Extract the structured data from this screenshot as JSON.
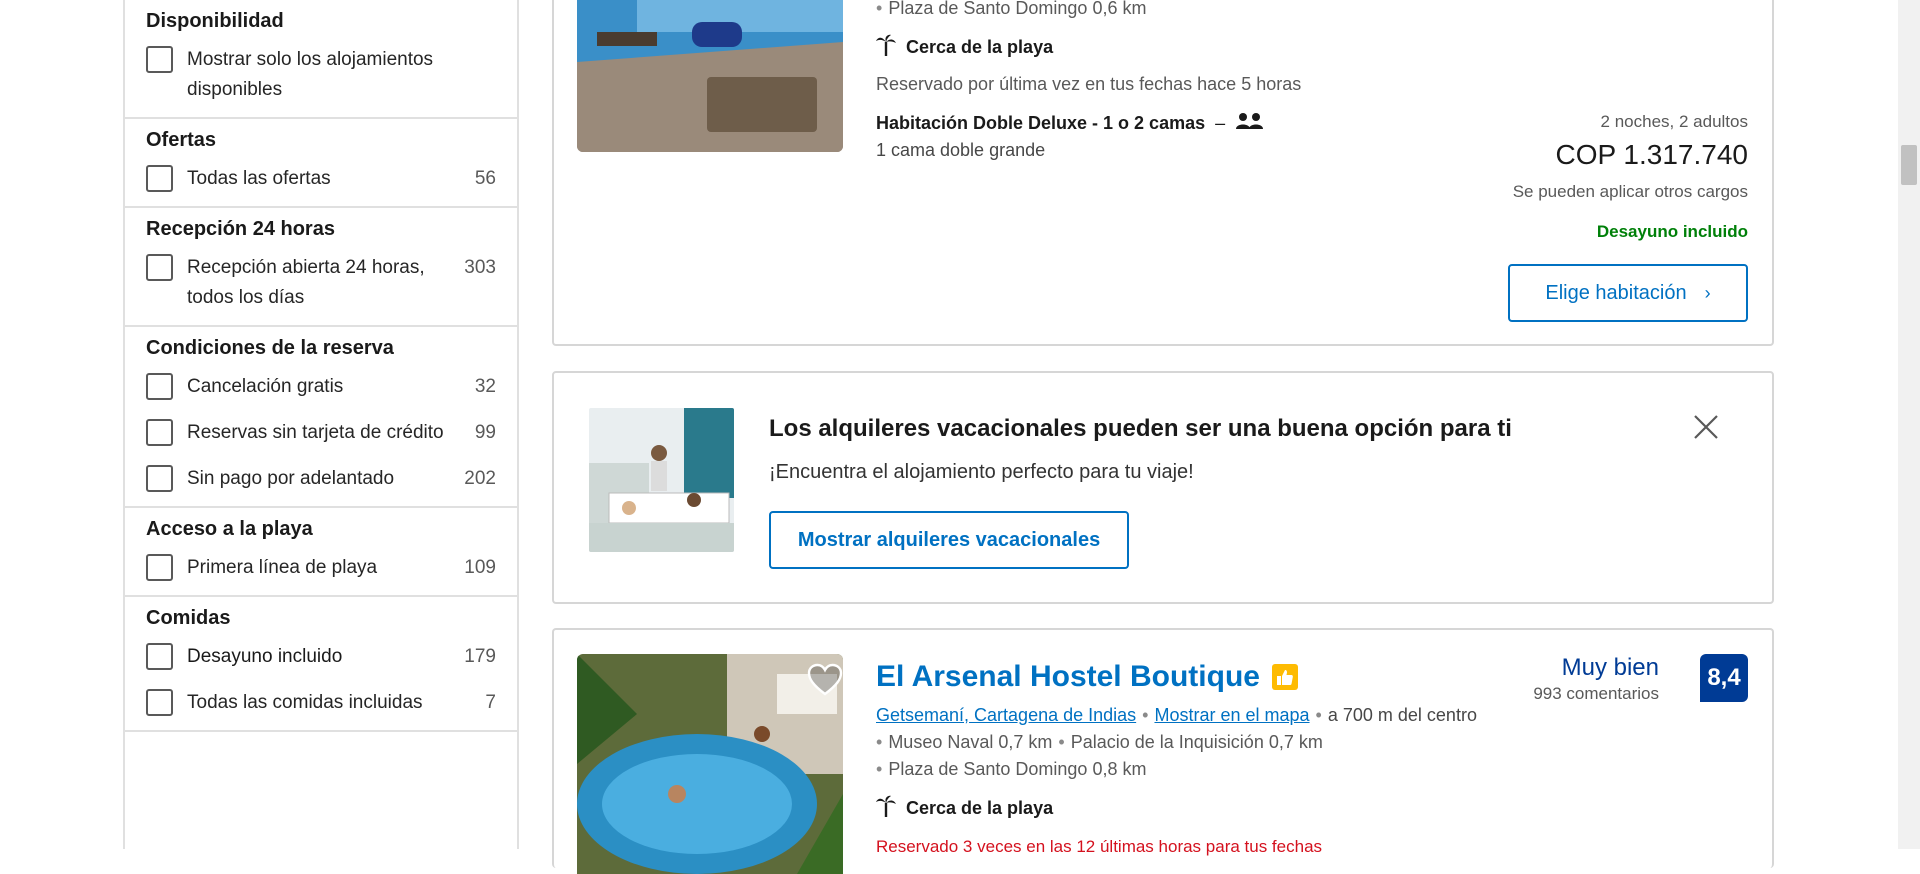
{
  "filters": [
    {
      "title": "Disponibilidad",
      "options": [
        {
          "label": "Mostrar solo los alojamientos disponibles",
          "count": ""
        }
      ]
    },
    {
      "title": "Ofertas",
      "options": [
        {
          "label": "Todas las ofertas",
          "count": "56"
        }
      ]
    },
    {
      "title": "Recepción 24 horas",
      "options": [
        {
          "label": "Recepción abierta 24 horas, todos los días",
          "count": "303"
        }
      ]
    },
    {
      "title": "Condiciones de la reserva",
      "options": [
        {
          "label": "Cancelación gratis",
          "count": "32"
        },
        {
          "label": "Reservas sin tarjeta de crédito",
          "count": "99"
        },
        {
          "label": "Sin pago por adelantado",
          "count": "202"
        }
      ]
    },
    {
      "title": "Acceso a la playa",
      "options": [
        {
          "label": "Primera línea de playa",
          "count": "109"
        }
      ]
    },
    {
      "title": "Comidas",
      "options": [
        {
          "label": "Desayuno incluido",
          "count": "179"
        },
        {
          "label": "Todas las comidas incluidas",
          "count": "7"
        }
      ]
    }
  ],
  "hotel1": {
    "landmark": "Plaza de Santo Domingo 0,6 km",
    "beach": "Cerca de la playa",
    "last_booked": "Reservado por última vez en tus fechas hace 5 horas",
    "room_name": "Habitación Doble Deluxe - 1 o 2 camas",
    "room_sep": "–",
    "bed": "1 cama doble grande",
    "nights": "2 noches, 2 adultos",
    "price": "COP 1.317.740",
    "charges": "Se pueden aplicar otros cargos",
    "breakfast": "Desayuno incluido",
    "cta": "Elige habitación"
  },
  "promo": {
    "title": "Los alquileres vacacionales pueden ser una buena opción para ti",
    "subtitle": "¡Encuentra el alojamiento perfecto para tu viaje!",
    "cta": "Mostrar alquileres vacacionales"
  },
  "hotel2": {
    "name": "El Arsenal Hostel Boutique",
    "rating_word": "Muy bien",
    "reviews": "993 comentarios",
    "score": "8,4",
    "area": "Getsemaní, Cartagena de Indias",
    "map": "Mostrar en el mapa",
    "distance": "a 700 m del centro",
    "landmark1": "Museo Naval 0,7 km",
    "landmark2": "Palacio de la Inquisición 0,7 km",
    "landmark3": "Plaza de Santo Domingo 0,8 km",
    "beach": "Cerca de la playa",
    "recent": "Reservado 3 veces en las 12 últimas horas para tus fechas"
  },
  "colors": {
    "brand": "#0071c2",
    "score_bg": "#003b95",
    "green": "#008009",
    "red": "#d4111e",
    "thumbs": "#febb02"
  }
}
